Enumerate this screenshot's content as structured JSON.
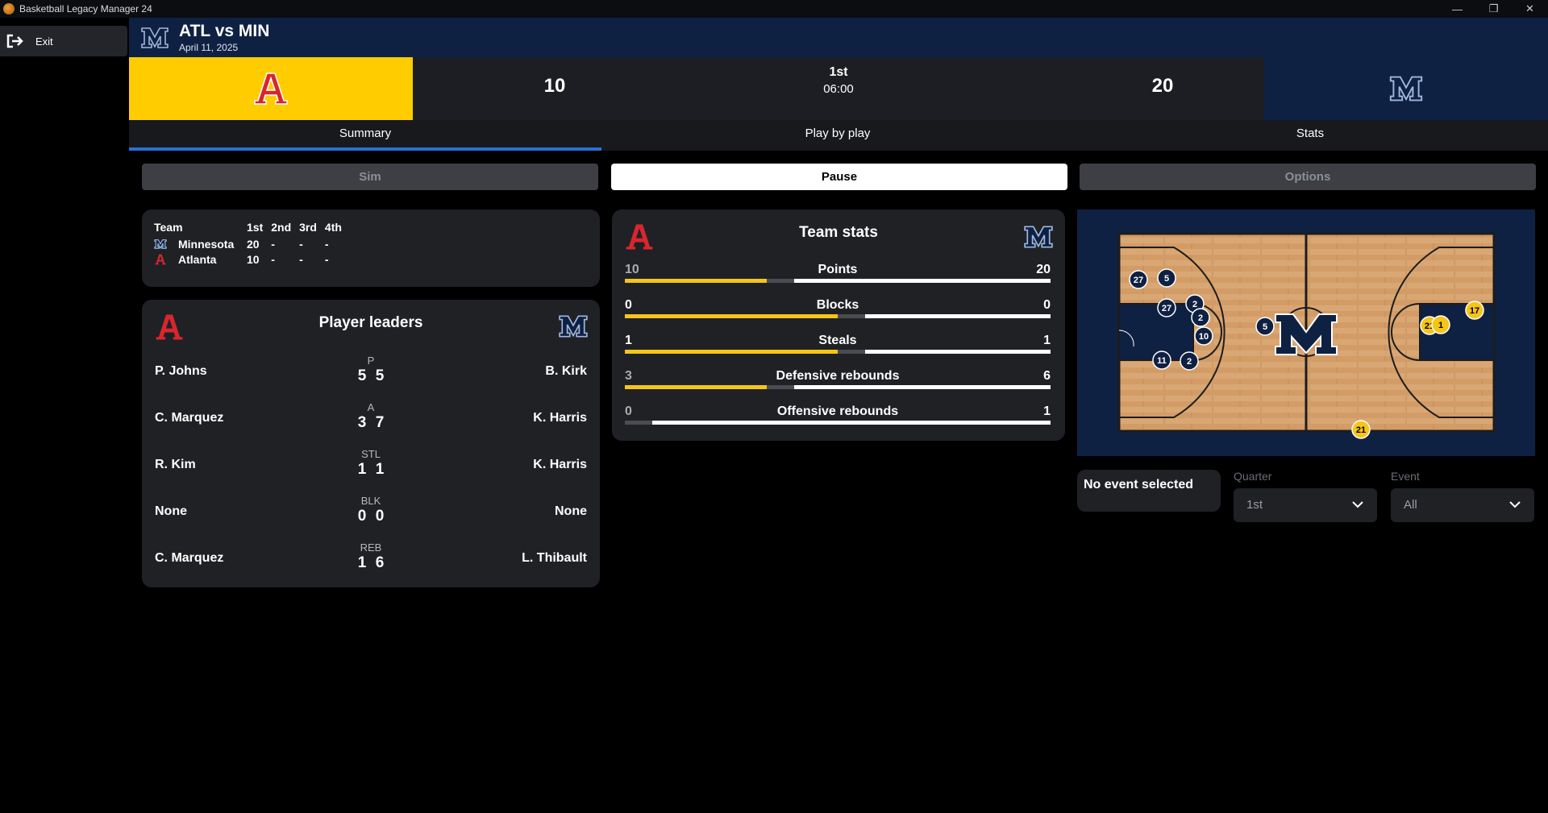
{
  "window": {
    "title": "Basketball Legacy Manager 24",
    "controls": [
      "—",
      "❐",
      "✕"
    ]
  },
  "sidebar": {
    "exit_label": "Exit"
  },
  "header": {
    "title": "ATL vs MIN",
    "date": "April 11, 2025"
  },
  "scoreboard": {
    "home_score": "10",
    "away_score": "20",
    "period": "1st",
    "clock": "06:00",
    "home_color": "#ffcc00",
    "away_color": "#0f2142"
  },
  "tabs": [
    "Summary",
    "Play by play",
    "Stats"
  ],
  "controls": {
    "sim_label": "Sim",
    "pause_label": "Pause",
    "options_label": "Options"
  },
  "quarter_scores": {
    "headers": [
      "Team",
      "1st",
      "2nd",
      "3rd",
      "4th"
    ],
    "rows": [
      {
        "team": "Minnesota",
        "q1": "20",
        "q2": "-",
        "q3": "-",
        "q4": "-"
      },
      {
        "team": "Atlanta",
        "q1": "10",
        "q2": "-",
        "q3": "-",
        "q4": "-"
      }
    ]
  },
  "player_leaders": {
    "title": "Player leaders",
    "rows": [
      {
        "cat": "P",
        "left_player": "P. Johns",
        "left_val": "5",
        "right_val": "5",
        "right_player": "B. Kirk"
      },
      {
        "cat": "A",
        "left_player": "C. Marquez",
        "left_val": "3",
        "right_val": "7",
        "right_player": "K. Harris"
      },
      {
        "cat": "STL",
        "left_player": "R. Kim",
        "left_val": "1",
        "right_val": "1",
        "right_player": "K. Harris"
      },
      {
        "cat": "BLK",
        "left_player": "None",
        "left_val": "0",
        "right_val": "0",
        "right_player": "None"
      },
      {
        "cat": "REB",
        "left_player": "C. Marquez",
        "left_val": "1",
        "right_val": "6",
        "right_player": "L. Thibault"
      }
    ]
  },
  "team_stats": {
    "title": "Team stats",
    "rows": [
      {
        "name": "Points",
        "left": "10",
        "right": "20",
        "left_frac": 0.333
      },
      {
        "name": "Blocks",
        "left": "0",
        "right": "0",
        "left_frac": 0.5
      },
      {
        "name": "Steals",
        "left": "1",
        "right": "1",
        "left_frac": 0.5
      },
      {
        "name": "Defensive rebounds",
        "left": "3",
        "right": "6",
        "left_frac": 0.333
      },
      {
        "name": "Offensive rebounds",
        "left": "0",
        "right": "1",
        "left_frac": 0.0
      }
    ]
  },
  "court": {
    "away_markers": [
      "27",
      "5",
      "27",
      "2",
      "2",
      "10",
      "5",
      "11",
      "2"
    ],
    "home_markers": [
      "17",
      "21",
      "1",
      "21"
    ],
    "home_marker_color": "#f5c518",
    "away_marker_color": "#0f2142"
  },
  "event_panel": {
    "text": "No event selected"
  },
  "filters": {
    "quarter": {
      "label": "Quarter",
      "value": "1st"
    },
    "event": {
      "label": "Event",
      "value": "All"
    }
  },
  "icons": [
    "exit-icon",
    "minnesota-logo",
    "atlanta-logo",
    "chevron-down-icon",
    "app-icon"
  ]
}
